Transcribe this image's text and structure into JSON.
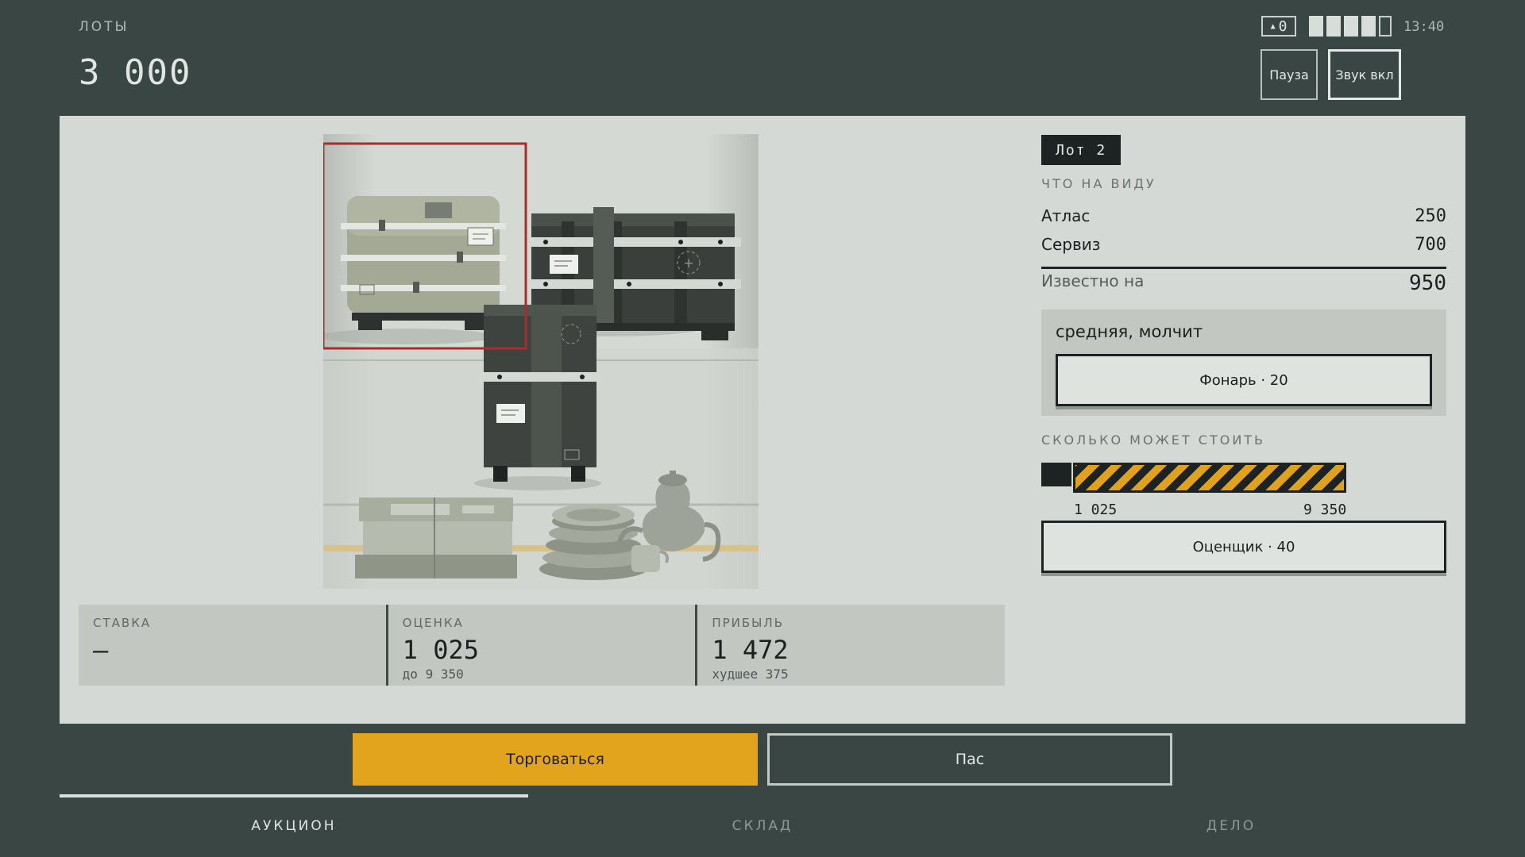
{
  "header": {
    "section_label": "ЛОТЫ",
    "money": "3 000",
    "alert_count": "0",
    "alert_icon": "triangle-up-icon",
    "battery_level": 0.8,
    "clock": "13:40",
    "pause_label": "Пауза",
    "sound_label": "Звук вкл"
  },
  "lot": {
    "badge": "Лот 2",
    "visible_label": "ЧТО НА ВИДУ",
    "items": [
      {
        "name": "Атлас",
        "value": "250"
      },
      {
        "name": "Сервиз",
        "value": "700"
      }
    ],
    "known_label": "Известно на",
    "known_value": "950"
  },
  "seller": {
    "description": "средняя, молчит",
    "lantern_button": "Фонарь · 20"
  },
  "worth": {
    "label": "СКОЛЬКО МОЖЕТ СТОИТЬ",
    "min": "1 025",
    "max": "9 350",
    "appraiser_button": "Оценщик · 40"
  },
  "stats": {
    "bid_label": "СТАВКА",
    "bid_value": "–",
    "estimate_label": "ОЦЕНКА",
    "estimate_value": "1 025",
    "estimate_sub": "до 9 350",
    "profit_label": "ПРИБЫЛЬ",
    "profit_value": "1 472",
    "profit_sub": "худшее 375"
  },
  "actions": {
    "haggle": "Торговаться",
    "pass": "Пас"
  },
  "tabs": [
    {
      "label": "АУКЦИОН",
      "active": true
    },
    {
      "label": "СКЛАД",
      "active": false
    },
    {
      "label": "ДЕЛО",
      "active": false
    }
  ],
  "colors": {
    "background": "#3a4643",
    "panel": "#d5d9d5",
    "accent": "#e2a41c",
    "highlight_frame": "#a3302a",
    "dark": "#1d2322"
  }
}
